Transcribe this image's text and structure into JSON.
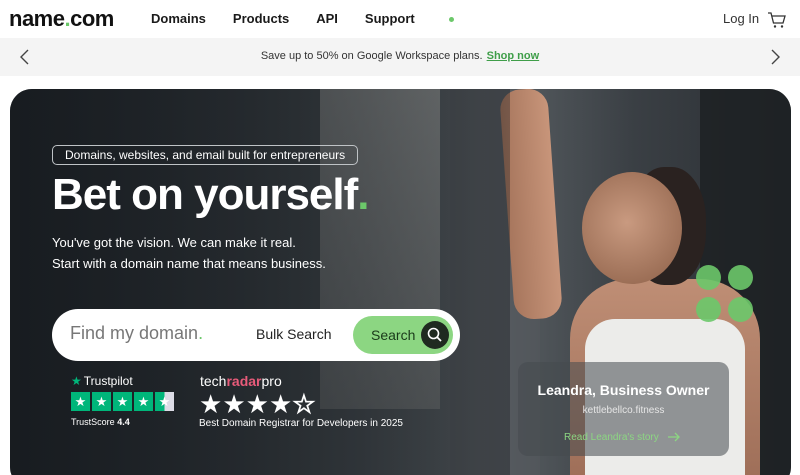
{
  "nav": {
    "logo_text": "name",
    "logo_dot": ".",
    "logo_suffix": "com",
    "items": [
      {
        "label": "Domains"
      },
      {
        "label": "Products"
      },
      {
        "label": "API"
      },
      {
        "label": "Support"
      }
    ],
    "login_label": "Log In",
    "cart_icon": "cart-icon"
  },
  "promo": {
    "text": "Save up to 50% on Google Workspace plans.",
    "link_label": "Shop now",
    "prev_icon": "chevron-left-icon",
    "next_icon": "chevron-right-icon"
  },
  "hero": {
    "tagline": "Domains, websites, and email built for entrepreneurs",
    "headline": "Bet on yourself",
    "headline_dot": ".",
    "sub_line1": "You've got the vision. We can make it real.",
    "sub_line2": "Start with a domain name that means business.",
    "search": {
      "placeholder": "Find my domain",
      "placeholder_dot": ".",
      "bulk_label": "Bulk Search",
      "button_label": "Search"
    },
    "trustpilot": {
      "brand": "Trustpilot",
      "rating_stars": 4.5,
      "score_label": "TrustScore",
      "score_value": "4.4"
    },
    "techradar": {
      "brand_prefix": "tech",
      "brand_mid": "radar",
      "brand_suffix": "pro",
      "stars_filled": 4,
      "stars_total": 5,
      "caption": "Best Domain Registrar for Developers in 2025"
    },
    "story": {
      "name": "Leandra, Business Owner",
      "site": "kettlebellco.fitness",
      "link_label": "Read Leandra's story"
    }
  },
  "colors": {
    "accent_green": "#6cc86a",
    "search_button": "#8cd682",
    "trustpilot_green": "#00b67a",
    "promo_link": "#3f9e49"
  }
}
